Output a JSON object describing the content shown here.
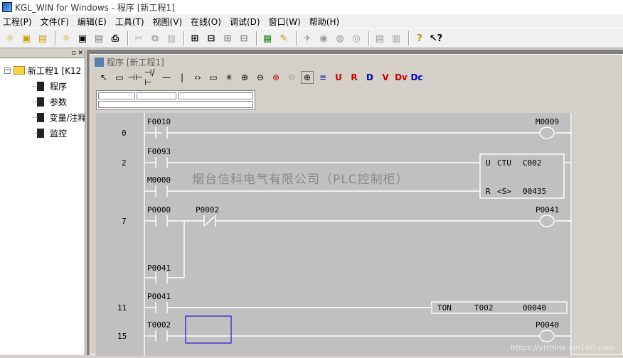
{
  "window": {
    "title": "KGL_WIN for Windows - 程序 [新工程1]"
  },
  "menu": [
    "工程(P)",
    "文件(F)",
    "编辑(E)",
    "工具(T)",
    "视图(V)",
    "在线(O)",
    "调试(D)",
    "窗口(W)",
    "帮助(H)"
  ],
  "tree": {
    "root": "新工程1 [K12",
    "children": [
      "程序",
      "参数",
      "变量/注释",
      "监控"
    ]
  },
  "child_window": {
    "title": "程序 [新工程1]"
  },
  "watermark": "烟台信科电气有限公司（PLC控制柜）",
  "footer": "https://ytthink.sm160.com",
  "ladder": {
    "steps": [
      "0",
      "2",
      "7",
      "11",
      "15"
    ],
    "contacts": [
      "F0010",
      "F0093",
      "M0000",
      "P0000",
      "P0002",
      "P0041",
      "P0041",
      "T0002"
    ],
    "coils": [
      "M0009",
      "P0041",
      "P0040"
    ],
    "ctu": {
      "line1_a": "U",
      "line1_b": "CTU",
      "line1_c": "C002",
      "line2_a": "R",
      "line2_b": "<S>",
      "line2_c": "00435"
    },
    "ton": {
      "a": "TON",
      "b": "T002",
      "c": "00040"
    }
  }
}
